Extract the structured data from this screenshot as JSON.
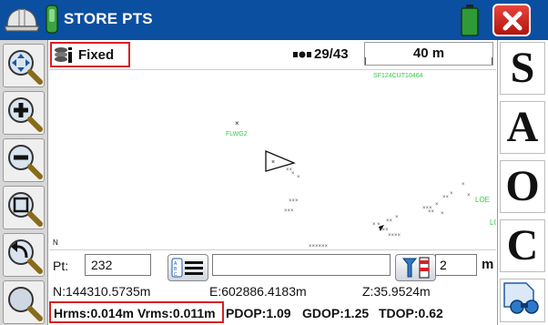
{
  "titlebar": {
    "title": "STORE PTS",
    "icons": [
      "hard-hat-icon",
      "rover-icon",
      "battery-icon",
      "close-icon"
    ],
    "colors": {
      "background": "#0b4fa0",
      "close": "#d81f26",
      "battery": "#2e9b36"
    }
  },
  "left_toolbar": {
    "buttons": [
      "zoom-pan-icon",
      "zoom-in-icon",
      "zoom-out-icon",
      "zoom-window-icon",
      "zoom-previous-icon",
      "zoom-extents-icon"
    ]
  },
  "right_toolbar": {
    "buttons": [
      "S",
      "A",
      "O",
      "C"
    ],
    "last_icon": "find-binoculars-icon"
  },
  "infobar": {
    "fix_status": "Fixed",
    "satellites": "29/43",
    "scale": "40 m"
  },
  "map": {
    "labels": {
      "top_code": "SF124CUT10464",
      "point_label": "FLWG2",
      "loe_1": "LOE",
      "loe_2": "LO"
    },
    "label_color": "#2ecc40",
    "north_indicator": "N"
  },
  "point_row": {
    "pt_label": "Pt:",
    "pt_value": "232",
    "description_value": "",
    "rod_height": "2",
    "rod_unit": "m"
  },
  "coordinates": {
    "north": "N:144310.5735m",
    "east": "E:602886.4183m",
    "elev": "Z:35.9524m"
  },
  "quality": {
    "hrms": "Hrms:0.014m",
    "vrms": "Vrms:0.011m",
    "pdop": "PDOP:1.09",
    "gdop": "GDOP:1.25",
    "tdop": "TDOP:0.62"
  }
}
